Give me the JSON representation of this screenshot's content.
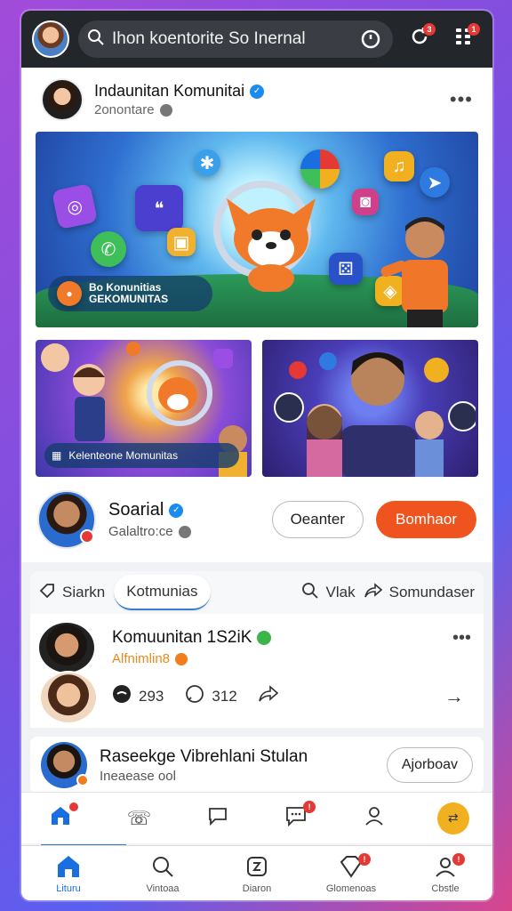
{
  "topbar": {
    "search_text": "Ihon koentorite So Inernal",
    "notif_badge": "3",
    "menu_badge": "1"
  },
  "post": {
    "author": "Indaunitan Komunitai",
    "subtitle": "2onontare",
    "hero_label_line1": "Bo Konunitias",
    "hero_label_line2": "GEKOMUNITAS",
    "thumb1_label": "Kelenteone Momunitas"
  },
  "profile": {
    "name": "Soarial",
    "subtitle": "Galaltro:ce",
    "outline_button": "Oeanter",
    "fill_button": "Bomhaor"
  },
  "tabs": {
    "tab1": "Siarkn",
    "tab2": "Kotmunias",
    "tab3": "Vlak",
    "tab4": "Somundaser"
  },
  "community": {
    "title": "Komuunitan 1S2iK",
    "subtitle": "Alfnimlin8",
    "likes": "293",
    "comments": "312"
  },
  "suggestion": {
    "title": "Raseekge Vibrehlani Stulan",
    "subtitle": "Ineaease ool",
    "button": "Ajorboav"
  },
  "bottomnav": {
    "home": "Lituru",
    "search": "Vintoaa",
    "create": "Diaron",
    "messages": "Glomenoas",
    "profile": "Cbstle"
  },
  "colors": {
    "accent": "#1a6fe0",
    "primary_button": "#f0541e",
    "topbar": "#23262b"
  }
}
